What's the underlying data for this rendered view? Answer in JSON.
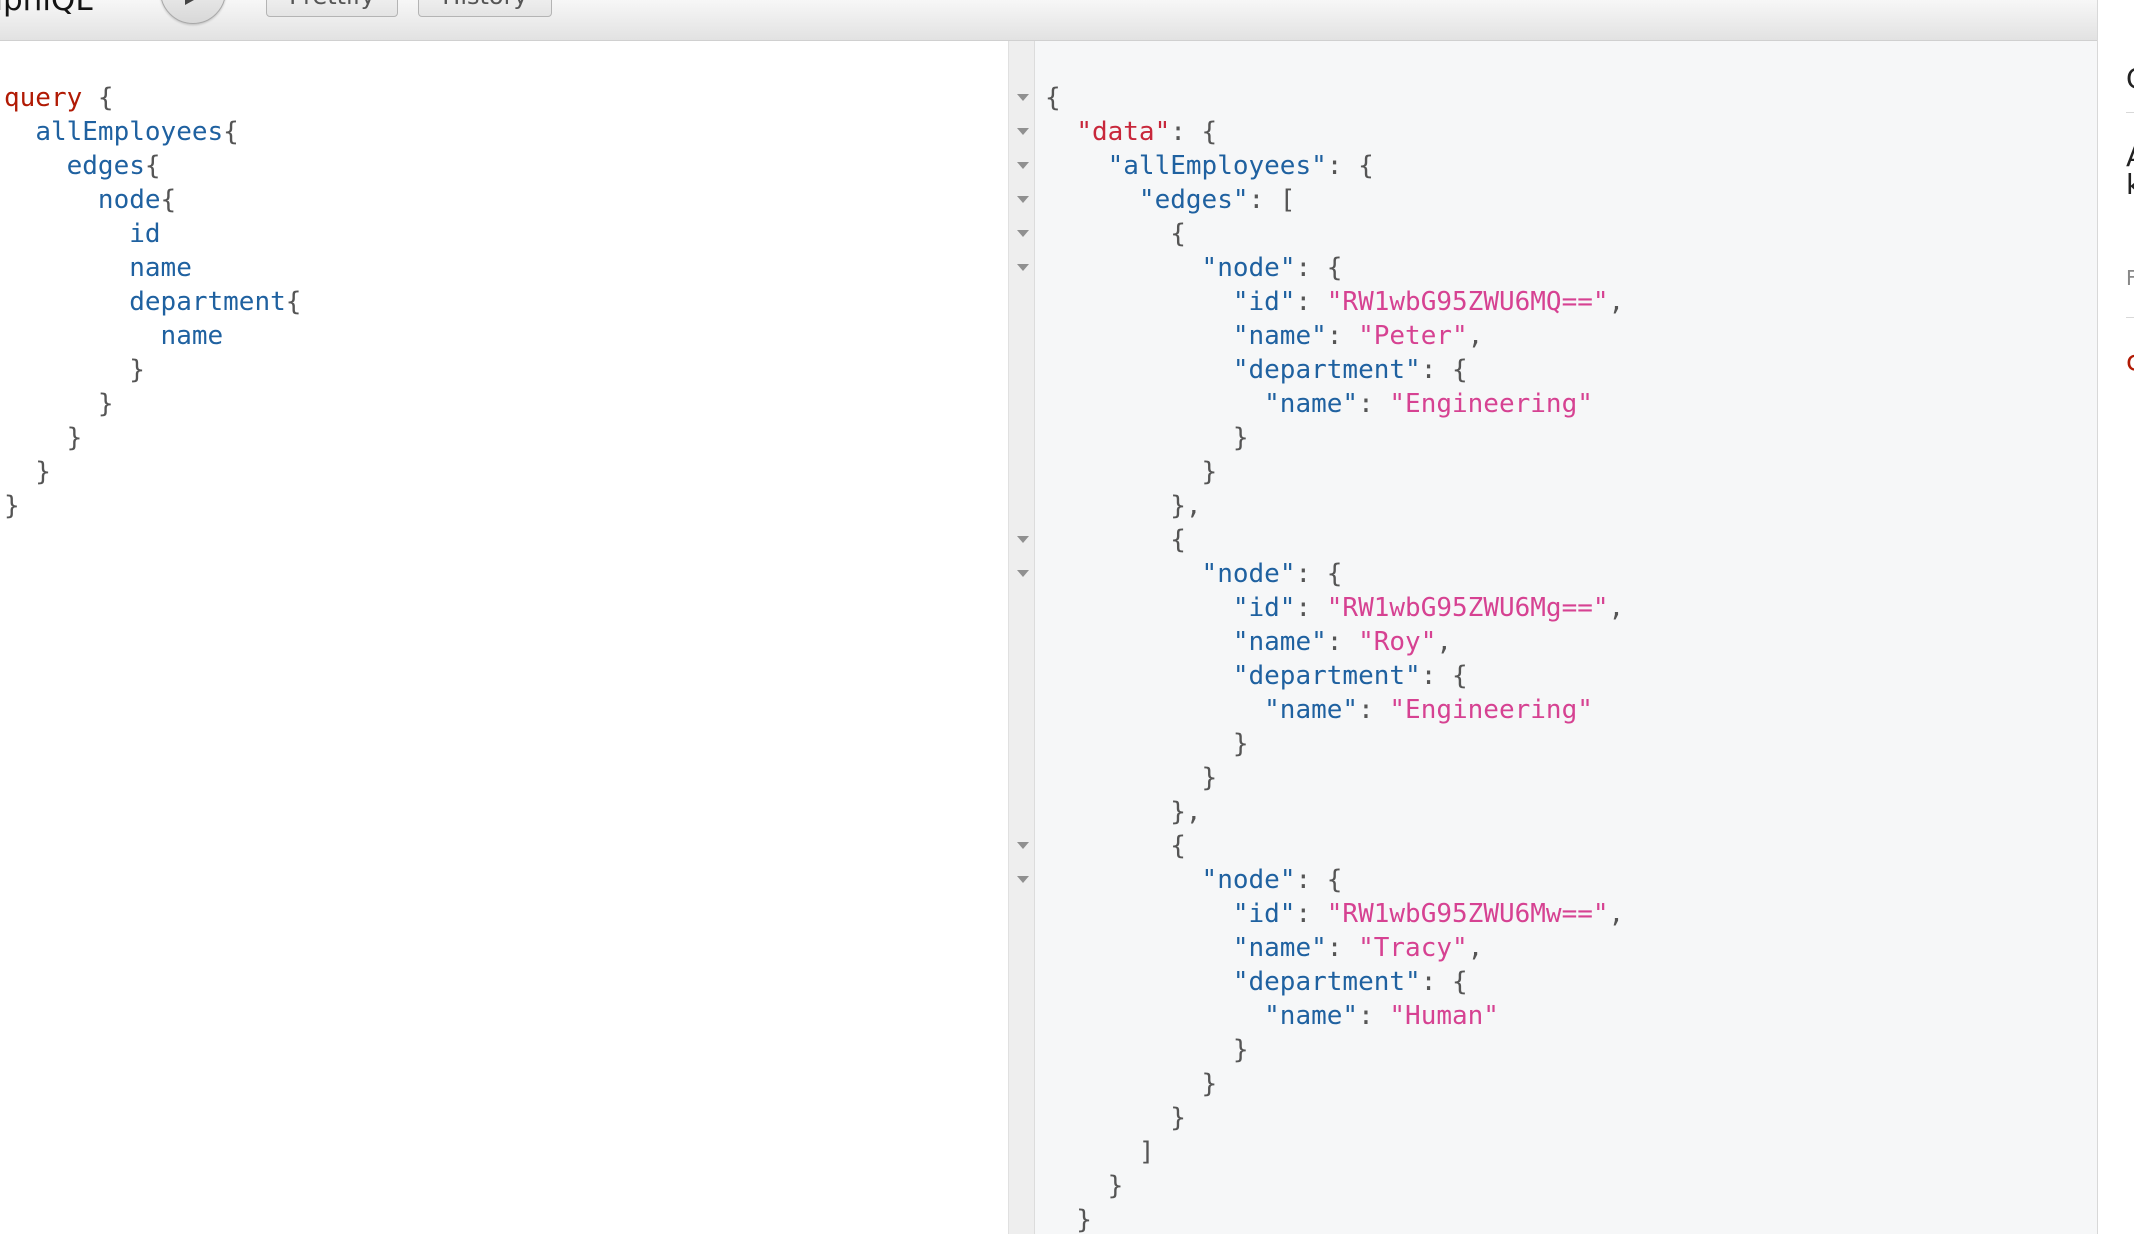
{
  "app": {
    "title_fragment": "aphiQL",
    "run_button_icon": "play-icon",
    "toolbar_buttons": [
      "Prettify",
      "History"
    ]
  },
  "query_editor": {
    "lines": [
      [
        {
          "t": "kw",
          "v": "query"
        },
        {
          "t": "p",
          "v": " {"
        }
      ],
      [
        {
          "t": "p",
          "v": "  "
        },
        {
          "t": "fld",
          "v": "allEmployees"
        },
        {
          "t": "p",
          "v": "{"
        }
      ],
      [
        {
          "t": "p",
          "v": "    "
        },
        {
          "t": "fld",
          "v": "edges"
        },
        {
          "t": "p",
          "v": "{"
        }
      ],
      [
        {
          "t": "p",
          "v": "      "
        },
        {
          "t": "fld",
          "v": "node"
        },
        {
          "t": "p",
          "v": "{"
        }
      ],
      [
        {
          "t": "p",
          "v": "        "
        },
        {
          "t": "fld",
          "v": "id"
        }
      ],
      [
        {
          "t": "p",
          "v": "        "
        },
        {
          "t": "fld",
          "v": "name"
        }
      ],
      [
        {
          "t": "p",
          "v": "        "
        },
        {
          "t": "fld",
          "v": "department"
        },
        {
          "t": "p",
          "v": "{"
        }
      ],
      [
        {
          "t": "p",
          "v": "          "
        },
        {
          "t": "fld",
          "v": "name"
        }
      ],
      [
        {
          "t": "p",
          "v": "        }"
        }
      ],
      [
        {
          "t": "p",
          "v": "      }"
        }
      ],
      [
        {
          "t": "p",
          "v": "    }"
        }
      ],
      [
        {
          "t": "p",
          "v": "  }"
        }
      ],
      [
        {
          "t": "p",
          "v": "}"
        }
      ]
    ]
  },
  "result_viewer": {
    "lines": [
      [
        {
          "t": "p",
          "v": "{"
        }
      ],
      [
        {
          "t": "p",
          "v": "  "
        },
        {
          "t": "key-data",
          "v": "\"data\""
        },
        {
          "t": "p",
          "v": ": {"
        }
      ],
      [
        {
          "t": "p",
          "v": "    "
        },
        {
          "t": "key",
          "v": "\"allEmployees\""
        },
        {
          "t": "p",
          "v": ": {"
        }
      ],
      [
        {
          "t": "p",
          "v": "      "
        },
        {
          "t": "key",
          "v": "\"edges\""
        },
        {
          "t": "p",
          "v": ": ["
        }
      ],
      [
        {
          "t": "p",
          "v": "        {"
        }
      ],
      [
        {
          "t": "p",
          "v": "          "
        },
        {
          "t": "key",
          "v": "\"node\""
        },
        {
          "t": "p",
          "v": ": {"
        }
      ],
      [
        {
          "t": "p",
          "v": "            "
        },
        {
          "t": "key",
          "v": "\"id\""
        },
        {
          "t": "p",
          "v": ": "
        },
        {
          "t": "str",
          "v": "\"RW1wbG95ZWU6MQ==\""
        },
        {
          "t": "p",
          "v": ","
        }
      ],
      [
        {
          "t": "p",
          "v": "            "
        },
        {
          "t": "key",
          "v": "\"name\""
        },
        {
          "t": "p",
          "v": ": "
        },
        {
          "t": "str",
          "v": "\"Peter\""
        },
        {
          "t": "p",
          "v": ","
        }
      ],
      [
        {
          "t": "p",
          "v": "            "
        },
        {
          "t": "key",
          "v": "\"department\""
        },
        {
          "t": "p",
          "v": ": {"
        }
      ],
      [
        {
          "t": "p",
          "v": "              "
        },
        {
          "t": "key",
          "v": "\"name\""
        },
        {
          "t": "p",
          "v": ": "
        },
        {
          "t": "str",
          "v": "\"Engineering\""
        }
      ],
      [
        {
          "t": "p",
          "v": "            }"
        }
      ],
      [
        {
          "t": "p",
          "v": "          }"
        }
      ],
      [
        {
          "t": "p",
          "v": "        },"
        }
      ],
      [
        {
          "t": "p",
          "v": "        {"
        }
      ],
      [
        {
          "t": "p",
          "v": "          "
        },
        {
          "t": "key",
          "v": "\"node\""
        },
        {
          "t": "p",
          "v": ": {"
        }
      ],
      [
        {
          "t": "p",
          "v": "            "
        },
        {
          "t": "key",
          "v": "\"id\""
        },
        {
          "t": "p",
          "v": ": "
        },
        {
          "t": "str",
          "v": "\"RW1wbG95ZWU6Mg==\""
        },
        {
          "t": "p",
          "v": ","
        }
      ],
      [
        {
          "t": "p",
          "v": "            "
        },
        {
          "t": "key",
          "v": "\"name\""
        },
        {
          "t": "p",
          "v": ": "
        },
        {
          "t": "str",
          "v": "\"Roy\""
        },
        {
          "t": "p",
          "v": ","
        }
      ],
      [
        {
          "t": "p",
          "v": "            "
        },
        {
          "t": "key",
          "v": "\"department\""
        },
        {
          "t": "p",
          "v": ": {"
        }
      ],
      [
        {
          "t": "p",
          "v": "              "
        },
        {
          "t": "key",
          "v": "\"name\""
        },
        {
          "t": "p",
          "v": ": "
        },
        {
          "t": "str",
          "v": "\"Engineering\""
        }
      ],
      [
        {
          "t": "p",
          "v": "            }"
        }
      ],
      [
        {
          "t": "p",
          "v": "          }"
        }
      ],
      [
        {
          "t": "p",
          "v": "        },"
        }
      ],
      [
        {
          "t": "p",
          "v": "        {"
        }
      ],
      [
        {
          "t": "p",
          "v": "          "
        },
        {
          "t": "key",
          "v": "\"node\""
        },
        {
          "t": "p",
          "v": ": {"
        }
      ],
      [
        {
          "t": "p",
          "v": "            "
        },
        {
          "t": "key",
          "v": "\"id\""
        },
        {
          "t": "p",
          "v": ": "
        },
        {
          "t": "str",
          "v": "\"RW1wbG95ZWU6Mw==\""
        },
        {
          "t": "p",
          "v": ","
        }
      ],
      [
        {
          "t": "p",
          "v": "            "
        },
        {
          "t": "key",
          "v": "\"name\""
        },
        {
          "t": "p",
          "v": ": "
        },
        {
          "t": "str",
          "v": "\"Tracy\""
        },
        {
          "t": "p",
          "v": ","
        }
      ],
      [
        {
          "t": "p",
          "v": "            "
        },
        {
          "t": "key",
          "v": "\"department\""
        },
        {
          "t": "p",
          "v": ": {"
        }
      ],
      [
        {
          "t": "p",
          "v": "              "
        },
        {
          "t": "key",
          "v": "\"name\""
        },
        {
          "t": "p",
          "v": ": "
        },
        {
          "t": "str",
          "v": "\"Human\""
        }
      ],
      [
        {
          "t": "p",
          "v": "            }"
        }
      ],
      [
        {
          "t": "p",
          "v": "          }"
        }
      ],
      [
        {
          "t": "p",
          "v": "        }"
        }
      ],
      [
        {
          "t": "p",
          "v": "      ]"
        }
      ],
      [
        {
          "t": "p",
          "v": "    }"
        }
      ],
      [
        {
          "t": "p",
          "v": "  }"
        }
      ]
    ],
    "fold_marker_icon": "fold-arrow-icon",
    "fold_marker_lines": [
      0,
      1,
      2,
      3,
      4,
      5,
      13,
      14,
      22,
      23
    ]
  },
  "doc_sidebar": {
    "fragments": [
      "C",
      "A",
      "k",
      "F",
      "c"
    ]
  },
  "colors": {
    "keyword": "#b11a04",
    "field": "#1f61a0",
    "json_key": "#1f61a0",
    "data_key": "#c8273b",
    "string": "#d64292",
    "punctuation": "#555555",
    "result_bg": "#f6f7f8"
  }
}
